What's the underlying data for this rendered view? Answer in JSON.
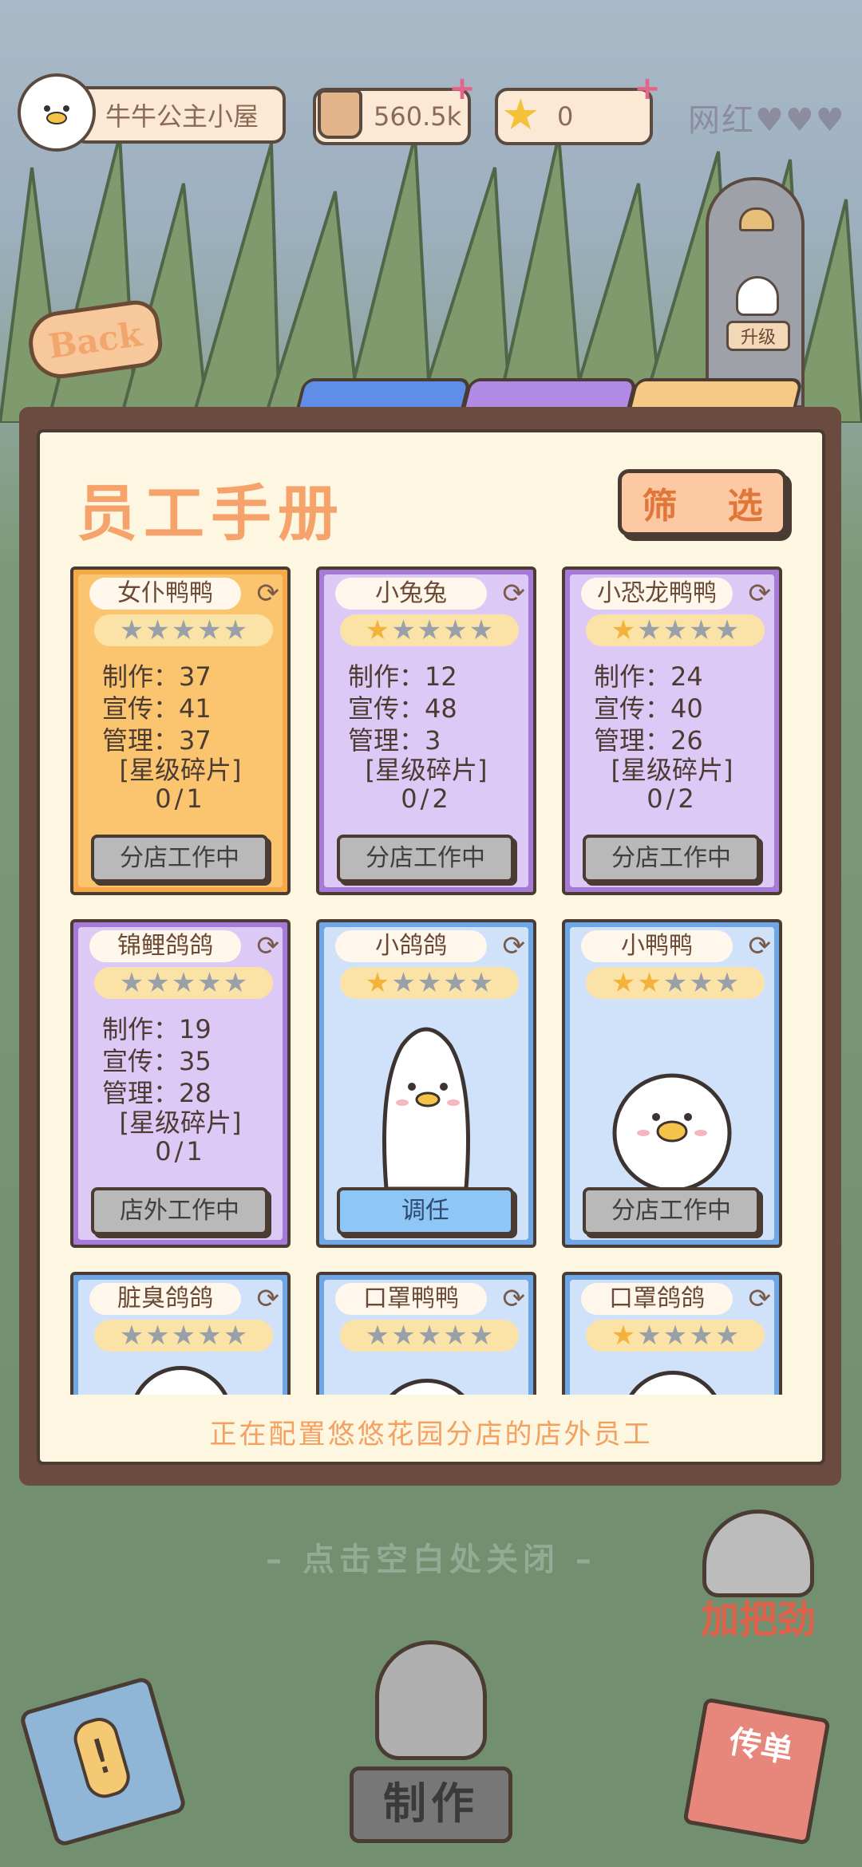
{
  "hud": {
    "shop_name": "牛牛公主小屋",
    "milk_tea_amount": "560.5k",
    "stars_amount": "0",
    "popularity_label": "网红"
  },
  "nav": {
    "back_label": "Back",
    "upgrade_label": "升级"
  },
  "colors": {
    "tab1": "#5f8ee6",
    "tab2": "#b18ae6",
    "tab3": "#f7c987"
  },
  "panel": {
    "title": "员工手册",
    "filter_label": "筛 选",
    "footer_hint": "正在配置悠悠花园分店的店外员工"
  },
  "stat_labels": {
    "make": "制作：",
    "promo": "宣传：",
    "manage": "管理：",
    "fragments": "[星级碎片]"
  },
  "employees": [
    {
      "name": "女仆鸭鸭",
      "stars": 0,
      "make": "37",
      "promo": "41",
      "manage": "37",
      "frag": "0/1",
      "status": "分店工作中",
      "color": "orange"
    },
    {
      "name": "小兔兔",
      "stars": 1,
      "make": "12",
      "promo": "48",
      "manage": "3",
      "frag": "0/2",
      "status": "分店工作中",
      "color": "purple"
    },
    {
      "name": "小恐龙鸭鸭",
      "stars": 1,
      "make": "24",
      "promo": "40",
      "manage": "26",
      "frag": "0/2",
      "status": "分店工作中",
      "color": "purple"
    },
    {
      "name": "锦鲤鸽鸽",
      "stars": 0,
      "make": "19",
      "promo": "35",
      "manage": "28",
      "frag": "0/1",
      "status": "店外工作中",
      "color": "purple"
    },
    {
      "name": "小鸽鸽",
      "stars": 1,
      "status": "调任",
      "color": "blue"
    },
    {
      "name": "小鸭鸭",
      "stars": 2,
      "status": "分店工作中",
      "color": "blue"
    },
    {
      "name": "脏臭鸽鸽",
      "stars": 0,
      "color": "blue"
    },
    {
      "name": "口罩鸭鸭",
      "stars": 0,
      "color": "blue"
    },
    {
      "name": "口罩鸽鸽",
      "stars": 1,
      "color": "blue"
    }
  ],
  "bottom": {
    "close_hint": "– 点击空白处关闭 –",
    "make_label": "制作",
    "cheer_label": "加把劲",
    "flyer_label": "传单"
  }
}
